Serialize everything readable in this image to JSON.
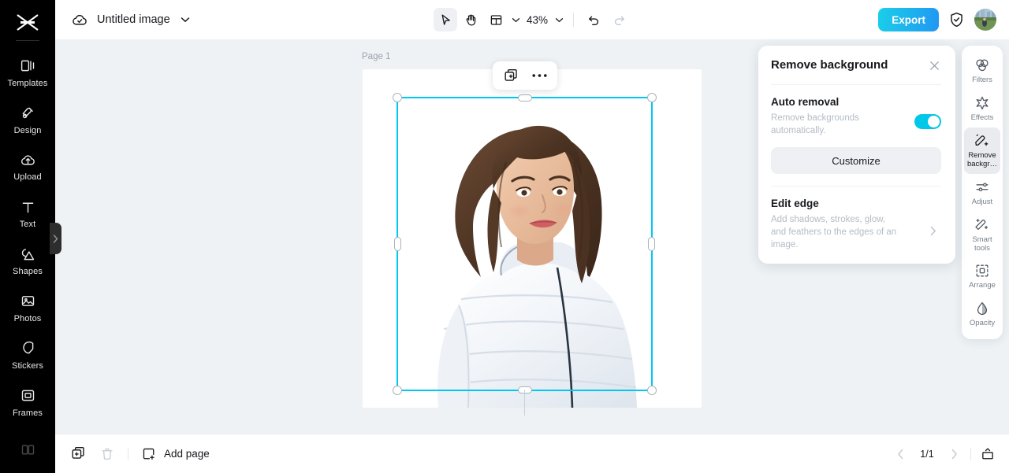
{
  "sidebar": {
    "logo_icon": "capcut-logo-icon",
    "items": [
      {
        "label": "Templates",
        "icon": "templates-icon"
      },
      {
        "label": "Design",
        "icon": "design-icon"
      },
      {
        "label": "Upload",
        "icon": "upload-cloud-icon"
      },
      {
        "label": "Text",
        "icon": "text-icon"
      },
      {
        "label": "Shapes",
        "icon": "shapes-icon"
      },
      {
        "label": "Photos",
        "icon": "photos-icon"
      },
      {
        "label": "Stickers",
        "icon": "stickers-icon"
      },
      {
        "label": "Frames",
        "icon": "frames-icon"
      },
      {
        "label": "",
        "icon": "layouts-icon"
      }
    ],
    "collapse_handle_icon": "chevron-right-icon"
  },
  "topbar": {
    "cloud_icon": "cloud-saved-icon",
    "document_title": "Untitled image",
    "title_chevron_icon": "chevron-down-icon",
    "tools": [
      {
        "name": "select-tool",
        "icon": "cursor-arrow-icon",
        "active": true
      },
      {
        "name": "hand-tool",
        "icon": "hand-icon",
        "active": false
      },
      {
        "name": "layout-tool",
        "icon": "layout-grid-icon",
        "active": false
      }
    ],
    "layout_chevron_icon": "chevron-down-icon",
    "zoom_level": "43%",
    "zoom_chevron_icon": "chevron-down-icon",
    "undo_icon": "undo-icon",
    "redo_icon": "redo-icon",
    "export_label": "Export",
    "shield_icon": "shield-check-icon",
    "avatar_icon": "user-avatar"
  },
  "canvas": {
    "page_label": "Page 1",
    "floating_toolbar": {
      "duplicate_icon": "duplicate-icon",
      "more_icon": "more-horizontal-icon"
    },
    "rotate_icon": "rotate-icon",
    "selection_color": "#00c8f0"
  },
  "panel": {
    "title": "Remove background",
    "close_icon": "close-icon",
    "auto_removal": {
      "title": "Auto removal",
      "description": "Remove backgrounds automatically.",
      "toggle_on": true,
      "toggle_color": "#00c8e8",
      "customize_label": "Customize"
    },
    "edit_edge": {
      "title": "Edit edge",
      "description": "Add shadows, strokes, glow, and feathers to the edges of an image.",
      "arrow_icon": "chevron-right-icon"
    }
  },
  "right_rail": {
    "items": [
      {
        "label": "Filters",
        "icon": "filters-icon",
        "active": false
      },
      {
        "label": "Effects",
        "icon": "effects-icon",
        "active": false
      },
      {
        "label": "Remove backgr…",
        "icon": "remove-bg-icon",
        "active": true
      },
      {
        "label": "Adjust",
        "icon": "adjust-sliders-icon",
        "active": false
      },
      {
        "label": "Smart tools",
        "icon": "smart-tools-icon",
        "active": false
      },
      {
        "label": "Arrange",
        "icon": "arrange-icon",
        "active": false
      },
      {
        "label": "Opacity",
        "icon": "opacity-drop-icon",
        "active": false
      }
    ]
  },
  "bottombar": {
    "duplicate_page_icon": "duplicate-page-icon",
    "delete_page_icon": "trash-icon",
    "add_page_label": "Add page",
    "add_page_icon": "add-page-icon",
    "prev_icon": "chevron-left-icon",
    "page_count": "1/1",
    "next_icon": "chevron-right-icon",
    "present_icon": "present-icon"
  },
  "colors": {
    "accent_cyan": "#00c8e8",
    "export_gradient_start": "#1ad0e8",
    "export_gradient_end": "#2196f3",
    "canvas_bg": "#eef2f5",
    "sidebar_bg": "#000000"
  }
}
